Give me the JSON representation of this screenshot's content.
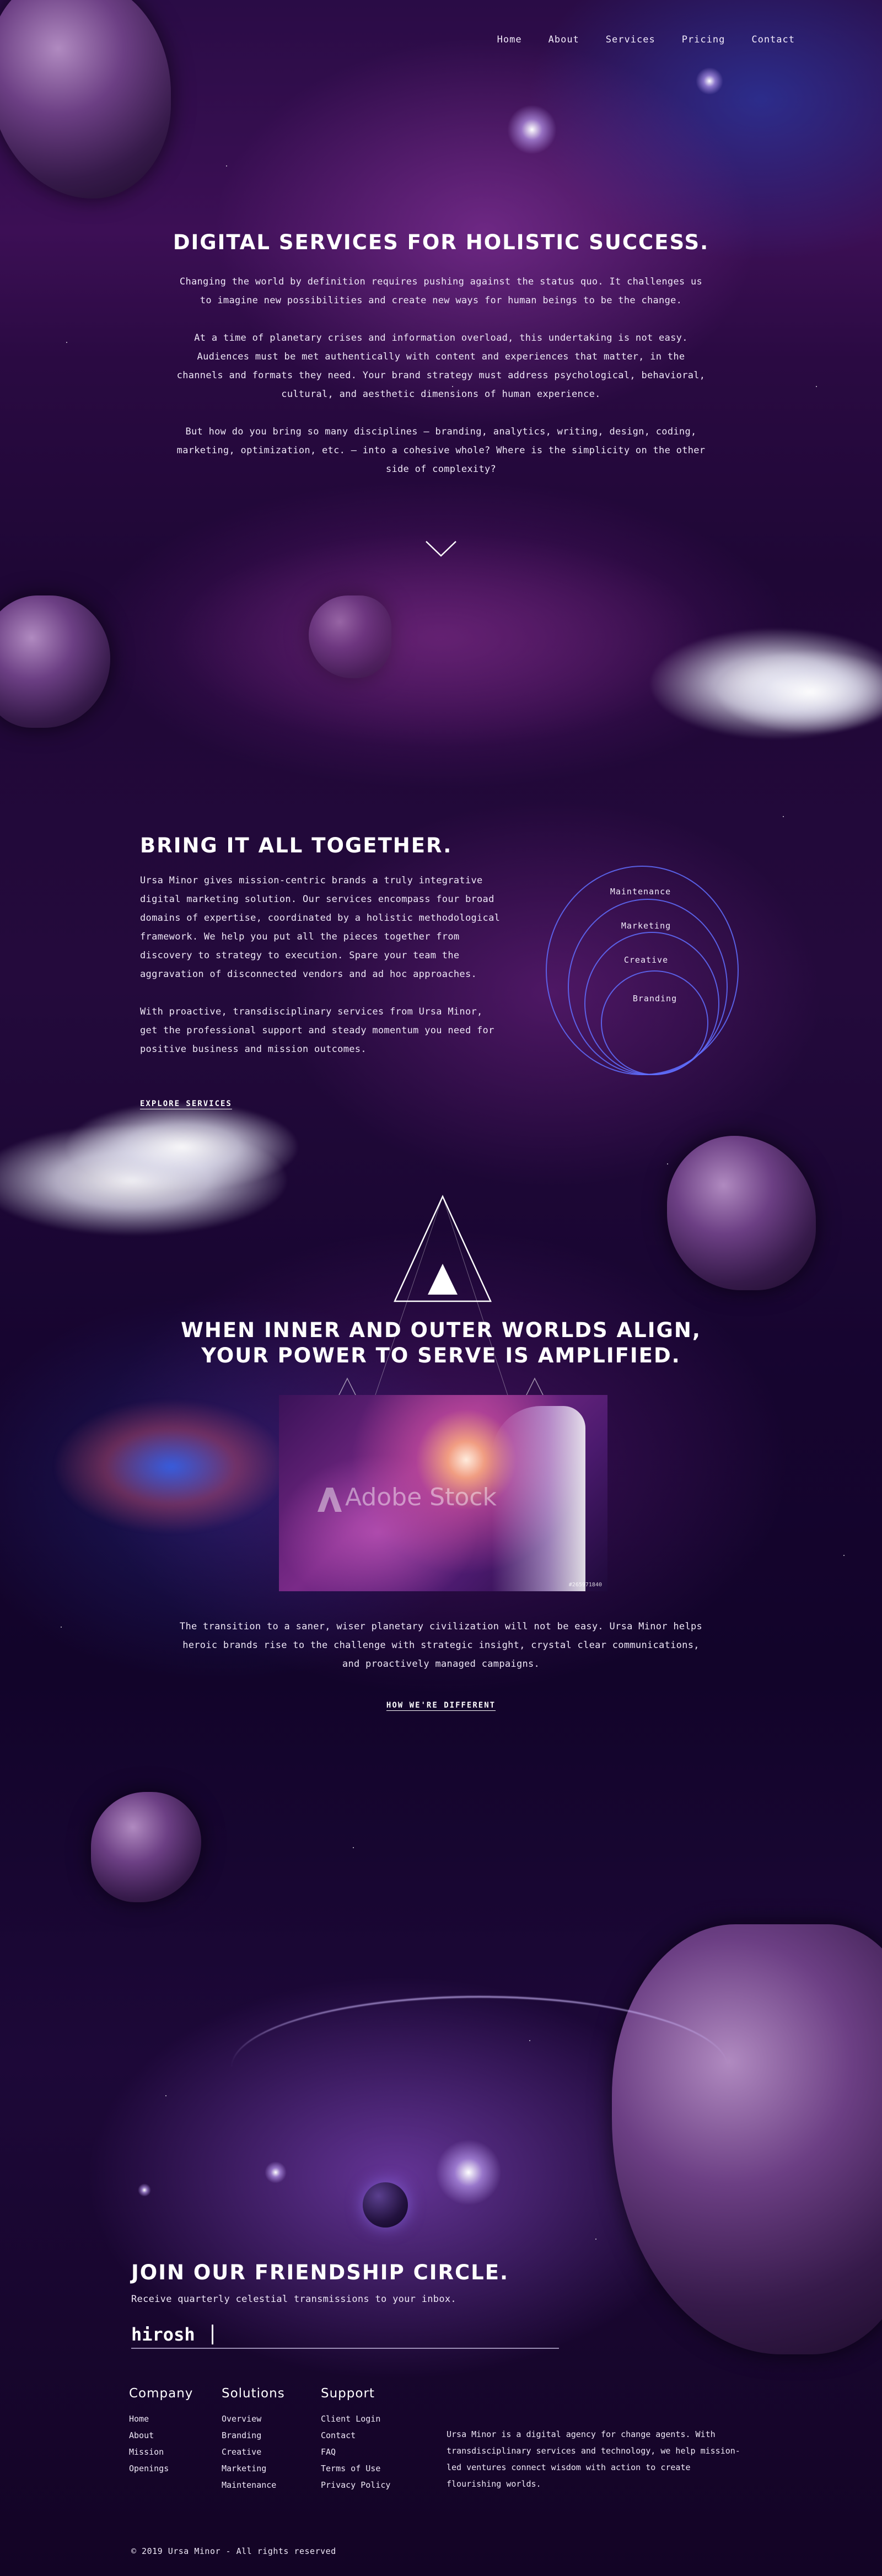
{
  "nav": {
    "items": [
      {
        "label": "Home"
      },
      {
        "label": "About"
      },
      {
        "label": "Services"
      },
      {
        "label": "Pricing"
      },
      {
        "label": "Contact"
      }
    ]
  },
  "hero": {
    "title": "DIGITAL SERVICES FOR HOLISTIC SUCCESS.",
    "paragraphs": [
      "Changing the world by definition requires pushing against the status quo. It challenges us to imagine new possibilities and create new ways for human beings to be the change.",
      "At a time of planetary crises and information overload, this undertaking is not easy. Audiences must be met authentically with content and experiences that matter, in the channels and formats they need. Your brand strategy must address psychological, behavioral, cultural, and aesthetic dimensions of human experience.",
      "But how do you bring so many disciplines – branding, analytics, writing, design, coding, marketing, optimization, etc. – into a cohesive whole?  Where is the simplicity on the other side of complexity?"
    ]
  },
  "together": {
    "title": "BRING IT ALL TOGETHER.",
    "paragraphs": [
      "Ursa Minor gives mission-centric brands a truly integrative digital marketing solution. Our services encompass four broad domains of expertise, coordinated by a holistic methodological framework. We help you put all the pieces together from discovery to strategy to execution. Spare your team the aggravation of disconnected vendors and ad hoc approaches.",
      "With proactive, transdisciplinary services from Ursa Minor, get the professional support and steady momentum you need for positive business and mission outcomes."
    ],
    "link": "EXPLORE SERVICES",
    "disciplines": [
      "Maintenance",
      "Marketing",
      "Creative",
      "Branding"
    ],
    "ring_color": "#606eff"
  },
  "align": {
    "title_line1": "WHEN INNER AND OUTER WORLDS ALIGN,",
    "title_line2": "YOUR POWER TO SERVE IS AMPLIFIED.",
    "image_watermark": "Adobe Stock",
    "image_id": "#265971840",
    "paragraph": "The transition to a saner, wiser planetary civilization will not be easy. Ursa Minor helps heroic brands rise to the challenge with strategic insight, crystal clear communications, and proactively managed campaigns.",
    "link": "HOW WE'RE DIFFERENT"
  },
  "join": {
    "title": "JOIN OUR FRIENDSHIP CIRCLE.",
    "subtitle": "Receive quarterly celestial transmissions to your inbox.",
    "input_value": "hirosh"
  },
  "footer": {
    "company": {
      "heading": "Company",
      "links": [
        "Home",
        "About",
        "Mission",
        "Openings"
      ]
    },
    "solutions": {
      "heading": "Solutions",
      "links": [
        "Overview",
        "Branding",
        "Creative",
        "Marketing",
        "Maintenance"
      ]
    },
    "support": {
      "heading": "Support",
      "links": [
        "Client Login",
        "Contact",
        "FAQ",
        "Terms of Use",
        "Privacy Policy"
      ]
    },
    "about": "Ursa Minor is a digital agency for change agents. With transdisciplinary services and technology, we help mission-led ventures connect wisdom with action to create flourishing worlds.",
    "copyright": "© 2019 Ursa Minor - All rights reserved"
  }
}
